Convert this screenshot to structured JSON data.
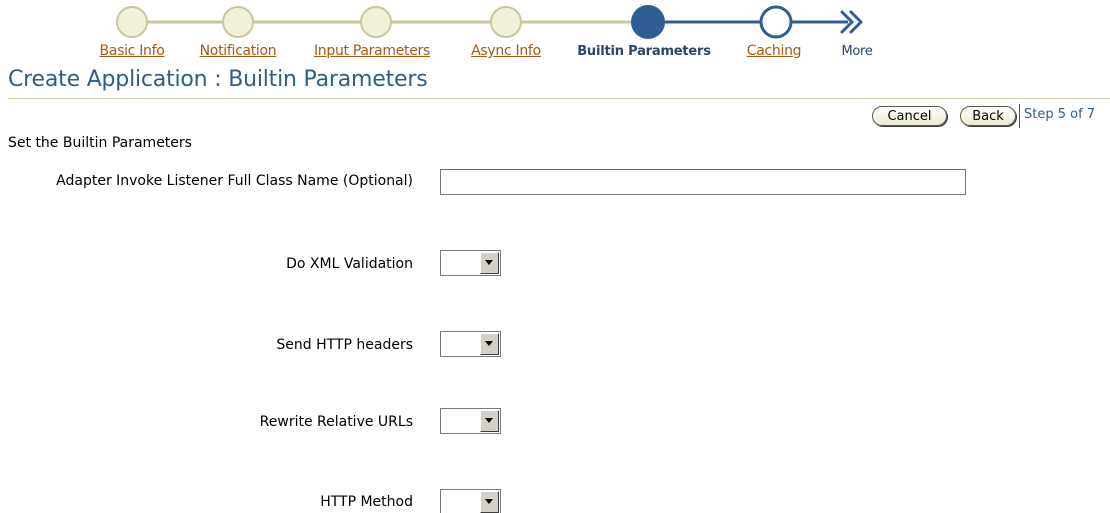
{
  "train": {
    "steps": [
      {
        "label": "Basic Info",
        "state": "visited"
      },
      {
        "label": "Notification",
        "state": "visited"
      },
      {
        "label": "Input Parameters",
        "state": "visited"
      },
      {
        "label": "Async Info",
        "state": "visited"
      },
      {
        "label": "Builtin Parameters",
        "state": "current"
      },
      {
        "label": "Caching",
        "state": "next"
      }
    ],
    "more_label": "More",
    "colors": {
      "visited_fill": "#f2f1da",
      "visited_stroke": "#c9c79d",
      "visited_line": "#d2d0a3",
      "current": "#2f5d94",
      "link": "#a85a14"
    }
  },
  "page": {
    "title": "Create Application : Builtin Parameters",
    "title_color": "#2f5d87"
  },
  "nav": {
    "cancel_label": "Cancel",
    "back_label": "Back",
    "step_text": "Step 5 of 7"
  },
  "form": {
    "instructions": "Set the Builtin Parameters",
    "adapter_label": "Adapter Invoke Listener Full Class Name (Optional)",
    "adapter_value": "",
    "xml_validation_label": "Do XML Validation",
    "xml_validation_value": "",
    "http_headers_label": "Send HTTP headers",
    "http_headers_value": "",
    "rewrite_urls_label": "Rewrite Relative URLs",
    "rewrite_urls_value": "",
    "http_method_label": "HTTP Method",
    "http_method_value": ""
  }
}
